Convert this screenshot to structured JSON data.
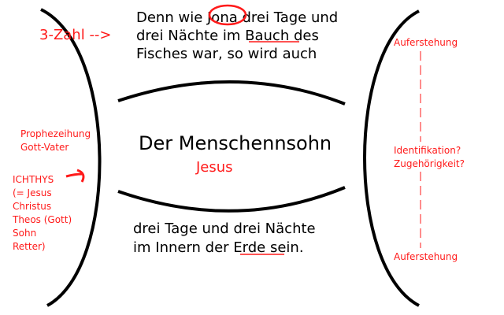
{
  "top_text": {
    "line1": "Denn wie Jona drei Tage und",
    "line2": "drei Nächte im Bauch des",
    "line3": "Fisches war, so wird auch"
  },
  "center": {
    "title": "Der Menschennsohn",
    "subtitle": "Jesus"
  },
  "bottom_text": {
    "line1": "drei Tage und drei Nächte",
    "line2": "im Innern der Erde sein."
  },
  "left_annotations": {
    "three_number": "3-Zahl -->",
    "prophecy": [
      "Prophezeihung",
      "Gott-Vater"
    ],
    "ichthys": [
      "ICHTHYS",
      "(= Jesus",
      "Christus",
      "Theos (Gott)",
      "Sohn",
      "Retter)"
    ]
  },
  "right_annotations": {
    "top": "Auferstehung",
    "middle": [
      "Identifikation?",
      "Zugehörigkeit?"
    ],
    "bottom": "Auferstehung"
  },
  "colors": {
    "annotation": "#ff1a1a",
    "text": "#000000"
  }
}
